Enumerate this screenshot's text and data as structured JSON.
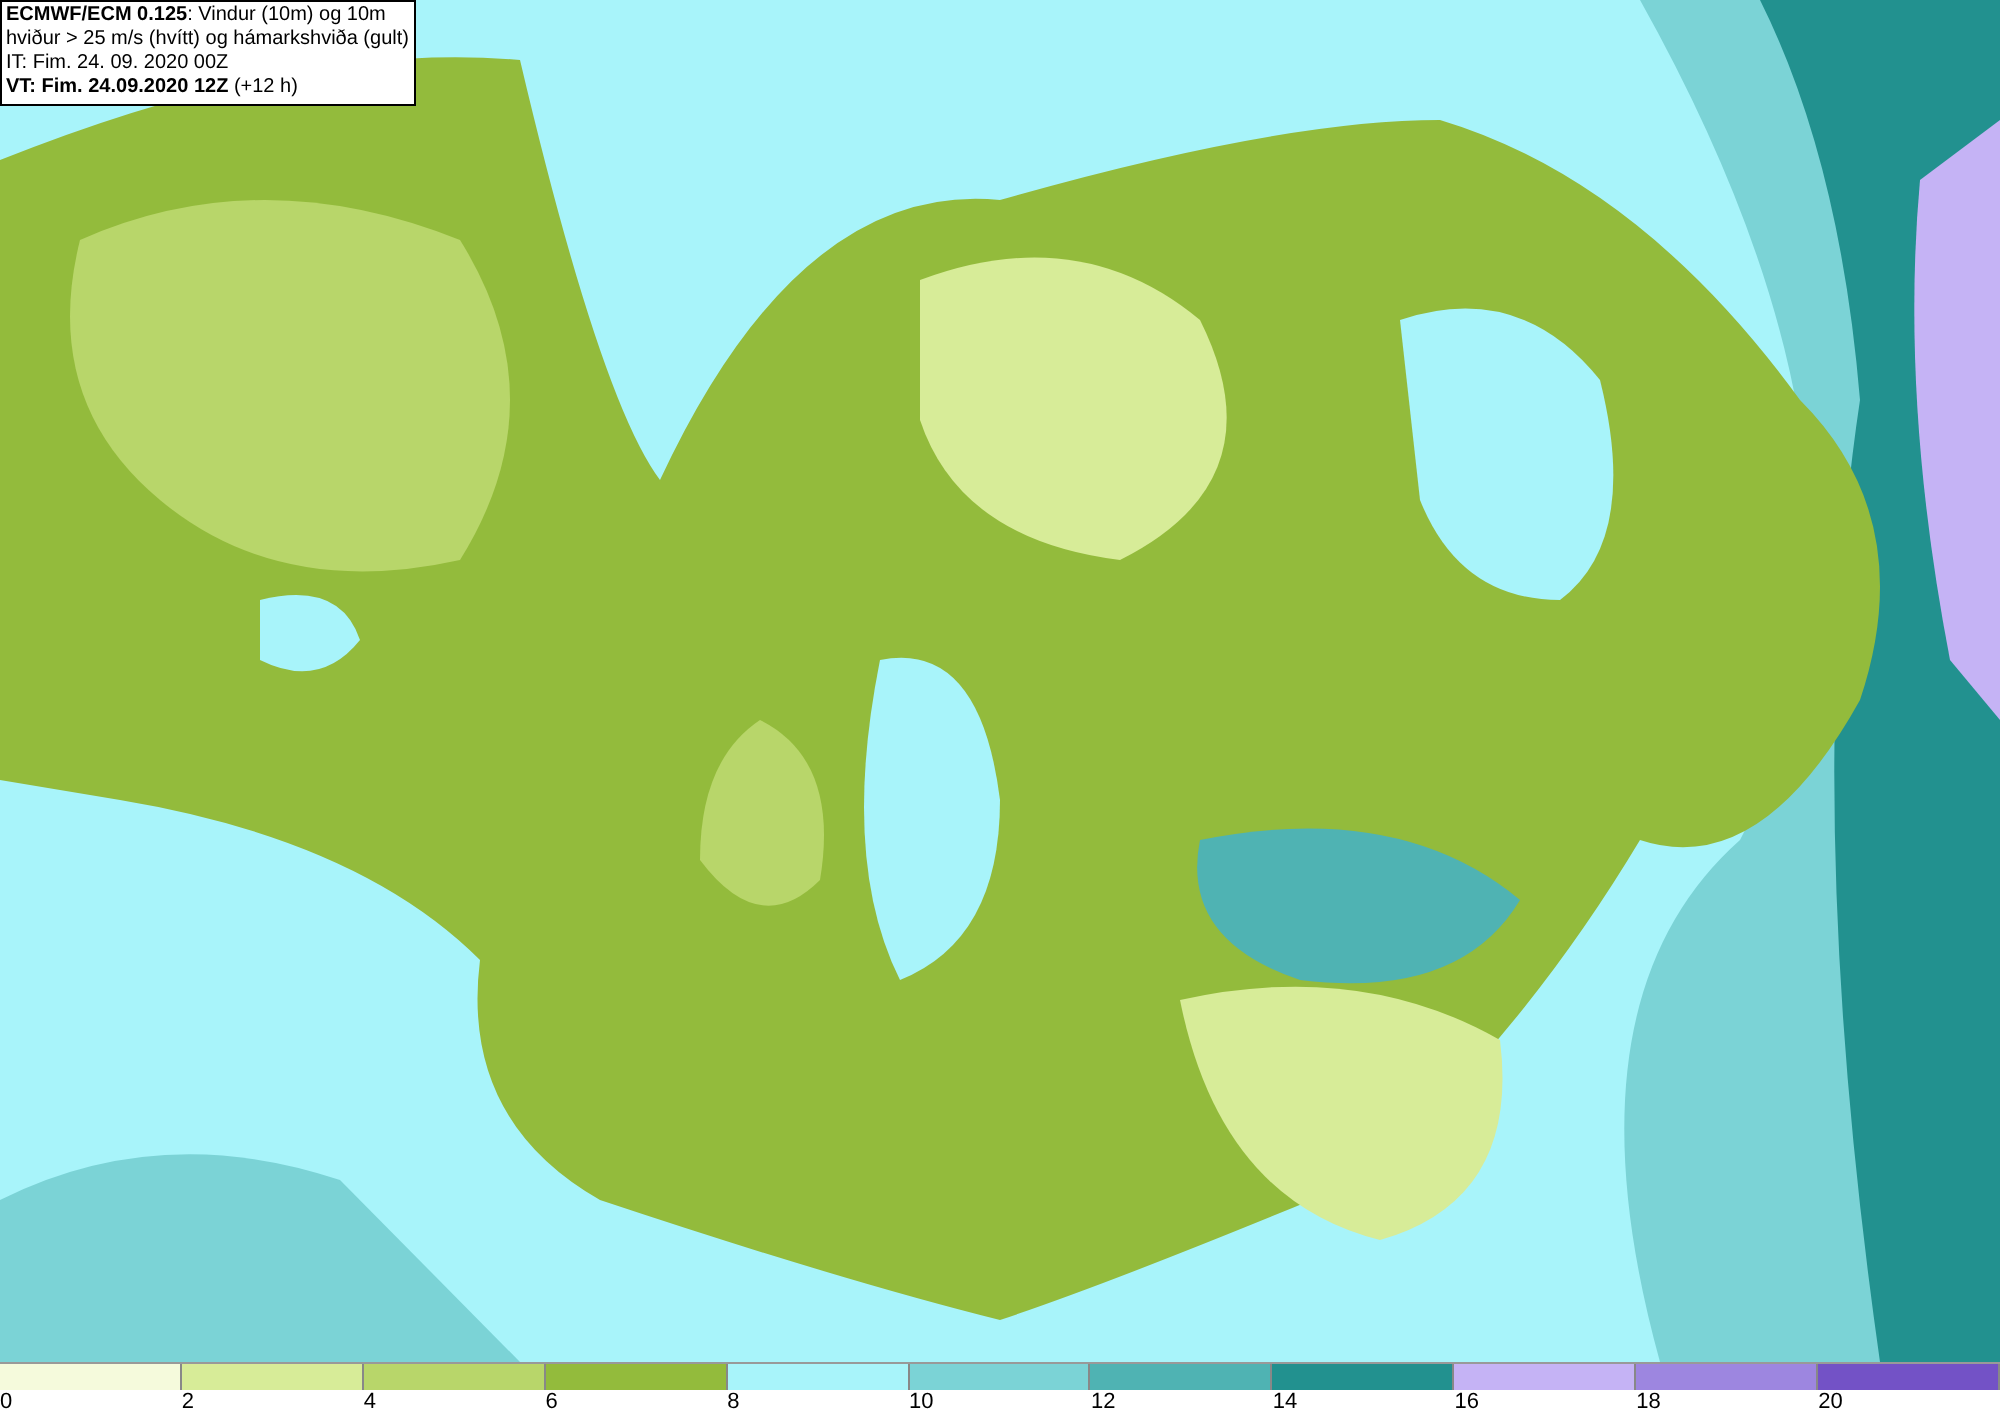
{
  "header": {
    "lines": [
      "**ECMWF/ECM 0.125**: Vindur (10m) og 10m",
      "hviður > 25 m/s (hvítt) og hámarkshviða (gult)",
      "IT: Fim. 24. 09. 2020 00Z",
      "**VT: Fim. 24.09.2020 12Z** (+12 h)"
    ]
  },
  "legend": [
    {
      "color": "#f5fadc",
      "label": "0"
    },
    {
      "color": "#d7ec98",
      "label": "2"
    },
    {
      "color": "#b8d66a",
      "label": "4"
    },
    {
      "color": "#93bb3c",
      "label": "6"
    },
    {
      "color": "#a8f4fa",
      "label": "8"
    },
    {
      "color": "#7bd3d6",
      "label": "10"
    },
    {
      "color": "#4fb3b3",
      "label": "12"
    },
    {
      "color": "#22918f",
      "label": "14"
    },
    {
      "color": "#c5b3f5",
      "label": "16"
    },
    {
      "color": "#9d86e0",
      "label": "18"
    },
    {
      "color": "#7352c6",
      "label": "20"
    }
  ]
}
